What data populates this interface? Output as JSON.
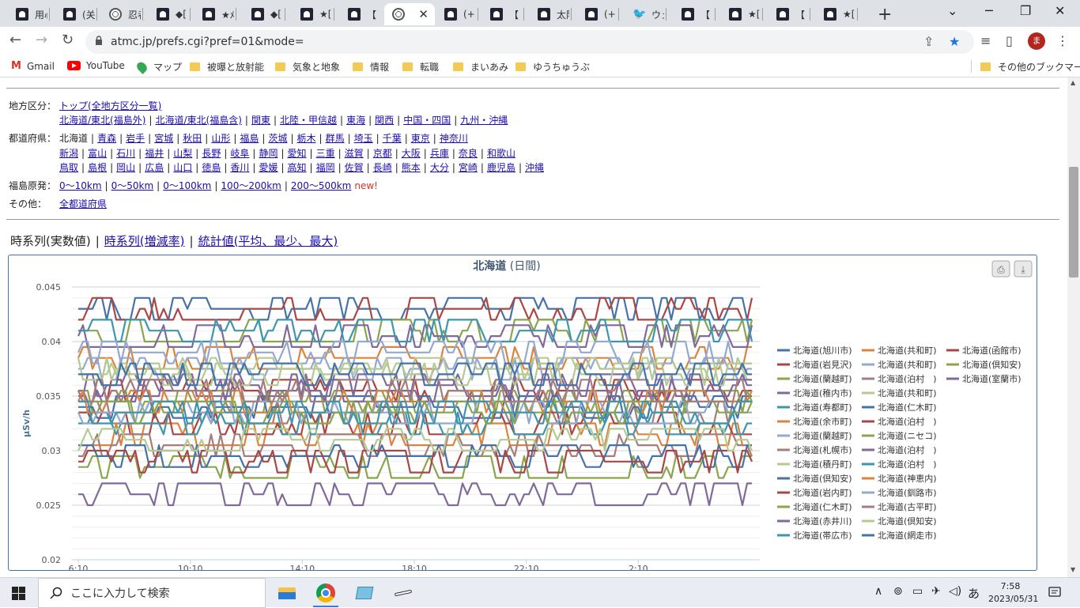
{
  "tabs": [
    {
      "label": "用心",
      "icon": "site-icon"
    },
    {
      "label": "(关",
      "icon": "site-icon"
    },
    {
      "label": "忍者",
      "icon": "globe-icon"
    },
    {
      "label": "◆[",
      "icon": "site-icon"
    },
    {
      "label": "★ﾒ",
      "icon": "site-icon"
    },
    {
      "label": "◆[",
      "icon": "site-icon"
    },
    {
      "label": "★[",
      "icon": "site-icon"
    },
    {
      "label": "【",
      "icon": "site-icon"
    },
    {
      "label": "",
      "icon": "globe-icon",
      "active": true
    },
    {
      "label": "(+",
      "icon": "site-icon"
    },
    {
      "label": "【",
      "icon": "site-icon"
    },
    {
      "label": "太阳",
      "icon": "site-icon"
    },
    {
      "label": "(+",
      "icon": "site-icon"
    },
    {
      "label": "ウェ",
      "icon": "twitter-icon"
    },
    {
      "label": "【",
      "icon": "site-icon"
    },
    {
      "label": "★[",
      "icon": "site-icon"
    },
    {
      "label": "【",
      "icon": "site-icon"
    },
    {
      "label": "★[",
      "icon": "site-icon"
    }
  ],
  "address": {
    "url": "atmc.jp/prefs.cgi?pref=01&mode="
  },
  "profile": {
    "initial": "ま"
  },
  "bookmarks": [
    "Gmail",
    "YouTube",
    "マップ",
    "被曝と放射能",
    "気象と地象",
    "情報",
    "転職",
    "まいあみ",
    "ゆうちゅうぶ"
  ],
  "bookmarks_other": "その他のブックマーク",
  "nav": {
    "region_label": "地方区分：",
    "region_top": "トップ(全地方区分一覧)",
    "regions": [
      "北海道/東北(福島外)",
      "北海道/東北(福島含)",
      "関東",
      "北陸・甲信越",
      "東海",
      "関西",
      "中国・四国",
      "九州・沖縄"
    ],
    "pref_label": "都道府県：",
    "pref_current": "北海道",
    "pref_row1": [
      "青森",
      "岩手",
      "宮城",
      "秋田",
      "山形",
      "福島",
      "茨城",
      "栃木",
      "群馬",
      "埼玉",
      "千葉",
      "東京",
      "神奈川"
    ],
    "pref_row2": [
      "新潟",
      "富山",
      "石川",
      "福井",
      "山梨",
      "長野",
      "岐阜",
      "静岡",
      "愛知",
      "三重",
      "滋賀",
      "京都",
      "大阪",
      "兵庫",
      "奈良",
      "和歌山"
    ],
    "pref_row3": [
      "鳥取",
      "島根",
      "岡山",
      "広島",
      "山口",
      "徳島",
      "香川",
      "愛媛",
      "高知",
      "福岡",
      "佐賀",
      "長崎",
      "熊本",
      "大分",
      "宮崎",
      "鹿児島",
      "沖縄"
    ],
    "fuku_label": "福島原発：",
    "fuku": [
      "0～10km",
      "0～50km",
      "0～100km",
      "100～200km",
      "200～500km"
    ],
    "fuku_new": "new!",
    "other_label": "その他：",
    "other": "全都道府県"
  },
  "view_tabs": {
    "current": "時系列(実数値)",
    "links": [
      "時系列(増減率)",
      "統計値(平均、最少、最大)"
    ]
  },
  "chart_data": {
    "type": "line",
    "title": "北海道",
    "subtitle": "(日間)",
    "ylabel": "μSv/h",
    "ylim": [
      0.02,
      0.045
    ],
    "yticks": [
      "0.02",
      "0.025",
      "0.03",
      "0.035",
      "0.04",
      "0.045"
    ],
    "xticks": [
      "6:10",
      "10:10",
      "14:10",
      "18:10",
      "22:10",
      "2:10"
    ],
    "grid": true,
    "legend_position": "right",
    "series": [
      {
        "name": "北海道(旭川市)",
        "color": "#4572a7",
        "base": 0.043
      },
      {
        "name": "北海道(共和町)",
        "color": "#db843d",
        "base": 0.0385
      },
      {
        "name": "北海道(函館市)",
        "color": "#aa4643",
        "base": 0.043
      },
      {
        "name": "北海道(岩見沢)",
        "color": "#aa4643",
        "base": 0.0355
      },
      {
        "name": "北海道(共和町)",
        "color": "#93a9cf",
        "base": 0.0375
      },
      {
        "name": "北海道(倶知安)",
        "color": "#89a54e",
        "base": 0.041
      },
      {
        "name": "北海道(蘭越町)",
        "color": "#89a54e",
        "base": 0.0345
      },
      {
        "name": "北海道(泊村　)",
        "color": "#a47d7c",
        "base": 0.0335
      },
      {
        "name": "北海道(室蘭市)",
        "color": "#80699b",
        "base": 0.0405
      },
      {
        "name": "北海道(稚内市)",
        "color": "#80699b",
        "base": 0.036
      },
      {
        "name": "北海道(共和町)",
        "color": "#b5ca92",
        "base": 0.0375
      },
      {
        "name": "北海道(寿都町)",
        "color": "#3d96ae",
        "base": 0.041
      },
      {
        "name": "北海道(仁木町)",
        "color": "#4572a7",
        "base": 0.034
      },
      {
        "name": "北海道(余市町)",
        "color": "#db843d",
        "base": 0.0315
      },
      {
        "name": "北海道(泊村　)",
        "color": "#aa4643",
        "base": 0.0325
      },
      {
        "name": "北海道(蘭越町)",
        "color": "#93a9cf",
        "base": 0.039
      },
      {
        "name": "北海道(ニセコ)",
        "color": "#89a54e",
        "base": 0.0285
      },
      {
        "name": "北海道(札幌市)",
        "color": "#a47d7c",
        "base": 0.0305
      },
      {
        "name": "北海道(泊村　)",
        "color": "#80699b",
        "base": 0.0355
      },
      {
        "name": "北海道(積丹町)",
        "color": "#b5ca92",
        "base": 0.037
      },
      {
        "name": "北海道(泊村　)",
        "color": "#3d96ae",
        "base": 0.0325
      },
      {
        "name": "北海道(倶知安)",
        "color": "#4572a7",
        "base": 0.0295
      },
      {
        "name": "北海道(神恵内)",
        "color": "#db843d",
        "base": 0.0345
      },
      {
        "name": "北海道(岩内町)",
        "color": "#aa4643",
        "base": 0.029
      },
      {
        "name": "北海道(釧路市)",
        "color": "#93a9cf",
        "base": 0.0335
      },
      {
        "name": "北海道(仁木町)",
        "color": "#89a54e",
        "base": 0.0335
      },
      {
        "name": "北海道(古平町)",
        "color": "#a47d7c",
        "base": 0.0355
      },
      {
        "name": "北海道(赤井川)",
        "color": "#80699b",
        "base": 0.026
      },
      {
        "name": "北海道(倶知安)",
        "color": "#b5ca92",
        "base": 0.031
      },
      {
        "name": "北海道(帯広市)",
        "color": "#3d96ae",
        "base": 0.0335
      },
      {
        "name": "北海道(網走市)",
        "color": "#4572a7",
        "base": 0.037
      }
    ]
  },
  "taskbar": {
    "search_placeholder": "ここに入力して検索",
    "time": "7:58",
    "date": "2023/05/31",
    "ime": "あ"
  }
}
